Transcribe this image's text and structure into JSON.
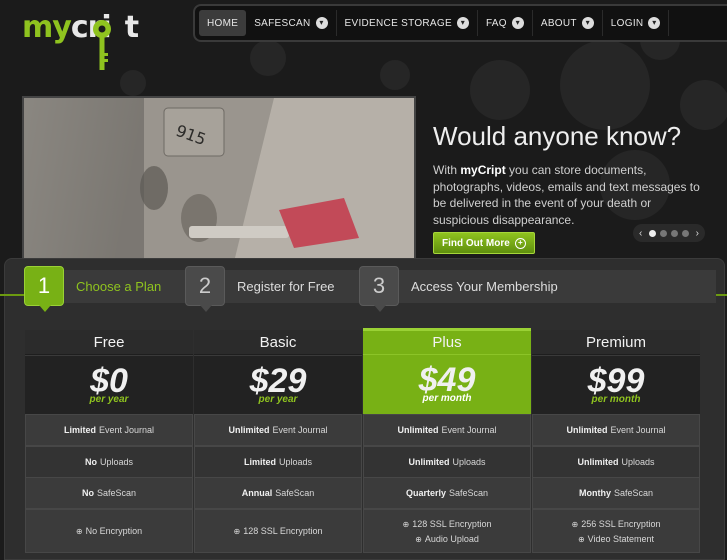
{
  "logo": {
    "my": "my",
    "rest": "cri",
    "end": "t"
  },
  "nav": {
    "items": [
      {
        "label": "HOME",
        "active": true,
        "dropdown": false
      },
      {
        "label": "SAFESCAN",
        "active": false,
        "dropdown": true
      },
      {
        "label": "EVIDENCE STORAGE",
        "active": false,
        "dropdown": true
      },
      {
        "label": "FAQ",
        "active": false,
        "dropdown": true
      },
      {
        "label": "ABOUT",
        "active": false,
        "dropdown": true
      },
      {
        "label": "LOGIN",
        "active": false,
        "dropdown": true
      }
    ]
  },
  "hero": {
    "title": "Would anyone know?",
    "desc_prefix": "With ",
    "desc_brand": "myCript",
    "desc_suffix": " you can store documents, photographs, videos, emails and text messages to be delivered in the event of your death or suspicious disappearance.",
    "button_label": "Find Out More",
    "image_text": "915",
    "slider": {
      "prev": "‹",
      "next": "›",
      "dots": 4,
      "active_dot": 0
    }
  },
  "steps": [
    {
      "num": "1",
      "label": "Choose a Plan",
      "active": true
    },
    {
      "num": "2",
      "label": "Register for Free",
      "active": false
    },
    {
      "num": "3",
      "label": "Access Your Membership",
      "active": false
    }
  ],
  "plans": [
    {
      "name": "Free",
      "price": "$0",
      "period": "per year",
      "journal_b": "Limited",
      "journal": "Event Journal",
      "uploads_b": "No",
      "uploads": "Uploads",
      "scan_b": "No",
      "scan": "SafeScan",
      "enc": [
        "No Encryption"
      ]
    },
    {
      "name": "Basic",
      "price": "$29",
      "period": "per year",
      "journal_b": "Unlimited",
      "journal": "Event Journal",
      "uploads_b": "Limited",
      "uploads": "Uploads",
      "scan_b": "Annual",
      "scan": "SafeScan",
      "enc": [
        "128 SSL Encryption"
      ]
    },
    {
      "name": "Plus",
      "price": "$49",
      "period": "per month",
      "journal_b": "Unlimited",
      "journal": "Event Journal",
      "uploads_b": "Unlimited",
      "uploads": "Uploads",
      "scan_b": "Quarterly",
      "scan": "SafeScan",
      "enc": [
        "128 SSL Encryption",
        "Audio Upload"
      ]
    },
    {
      "name": "Premium",
      "price": "$99",
      "period": "per month",
      "journal_b": "Unlimited",
      "journal": "Event Journal",
      "uploads_b": "Unlimited",
      "uploads": "Uploads",
      "scan_b": "Monthy",
      "scan": "SafeScan",
      "enc": [
        "256 SSL Encryption",
        "Video Statement"
      ]
    }
  ],
  "colors": {
    "accent": "#8fc31f",
    "featured": "#78b115",
    "background": "#1b1b1b"
  },
  "icons": {
    "nav_dropdown": "chevron-down-icon",
    "button": "plus-circle-icon",
    "encryption": "lock-icon"
  }
}
